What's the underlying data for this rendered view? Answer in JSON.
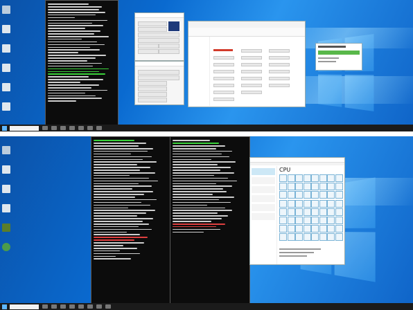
{
  "top_screen": {
    "taskbar": {
      "clock": ""
    },
    "notification": {
      "title": ""
    }
  },
  "bottom_screen": {
    "task_manager": {
      "tab_title": "CPU",
      "utilization_value": "",
      "speed_value": ""
    },
    "taskbar": {
      "clock": ""
    }
  },
  "colors": {
    "cmd_bg": "#0c0c0c",
    "cmd_text": "#cfcfcf",
    "cmd_green": "#3ad13a",
    "cmd_red": "#e04040",
    "desktop_blue": "#0a6ad0",
    "win_bg": "#f6f6f6",
    "accent_green": "#59b84a",
    "accent_red": "#d23a2a"
  },
  "icons": [
    "recycle-bin-icon",
    "file-icon",
    "start-icon",
    "search-icon",
    "windows-logo-icon",
    "cpu-icon"
  ]
}
